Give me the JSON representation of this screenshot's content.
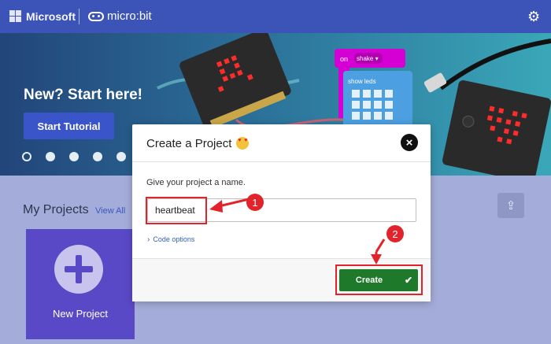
{
  "header": {
    "microsoft_label": "Microsoft",
    "product_label": "micro:bit"
  },
  "hero": {
    "title": "New? Start here!",
    "start_button": "Start Tutorial",
    "block1": "on",
    "block1_value": "shake ▾",
    "block2": "show leds"
  },
  "projects": {
    "heading": "My Projects",
    "view_all": "View All",
    "new_project_label": "New Project"
  },
  "dialog": {
    "title": "Create a Project",
    "prompt": "Give your project a name.",
    "input_value": "heartbeat",
    "code_options": "Code options",
    "create_label": "Create"
  },
  "annotations": {
    "step1": "1",
    "step2": "2",
    "highlight_color": "#e2232b"
  },
  "colors": {
    "topbar": "#3c54b8",
    "create_button": "#1e7a2a",
    "new_project_tile": "#5a49c6"
  },
  "icons": {
    "settings": "gear-icon",
    "close": "close-icon",
    "import": "upload-icon",
    "add": "plus-icon"
  }
}
